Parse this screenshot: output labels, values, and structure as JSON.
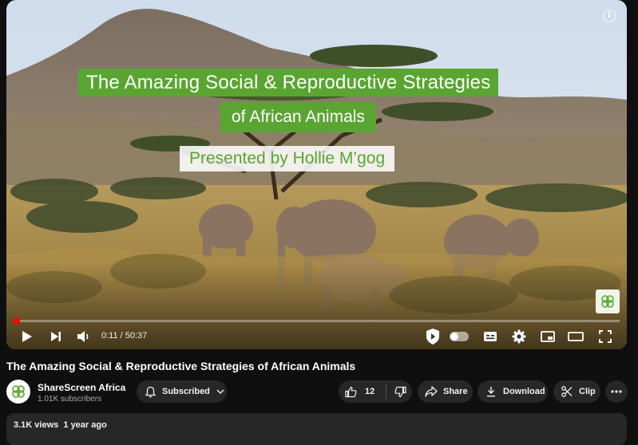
{
  "video": {
    "title_card_line1": "The Amazing Social & Reproductive Strategies",
    "title_card_line2": "of African Animals",
    "title_card_line3": "Presented by Hollie M’gog",
    "current_time": "0:11",
    "duration": "50:37",
    "progress_fraction": 0.0036,
    "info_icon_glyph": "i"
  },
  "title": "The Amazing Social & Reproductive Strategies of African Animals",
  "channel": {
    "name": "ShareScreen Africa",
    "subscribers": "1.01K subscribers",
    "subscribe_label": "Subscribed"
  },
  "actions": {
    "like_count": "12",
    "share_label": "Share",
    "download_label": "Download",
    "clip_label": "Clip"
  },
  "description": {
    "views": "3.1K views",
    "age": "1 year ago"
  },
  "colors": {
    "brand_green": "#5aa532",
    "progress_red": "#ff0000",
    "background": "#0f0f0f",
    "pill_bg": "#272727"
  },
  "icons": {
    "play": "play-icon",
    "next": "next-icon",
    "volume": "volume-icon",
    "bell": "bell-icon",
    "like": "thumbs-up-icon",
    "dislike": "thumbs-down-icon",
    "share": "share-icon",
    "download": "download-icon",
    "clip": "scissors-icon",
    "more": "more-icon",
    "settings": "gear-icon",
    "captions": "captions-icon",
    "miniplayer": "miniplayer-icon",
    "theater": "theater-icon",
    "fullscreen": "fullscreen-icon"
  }
}
